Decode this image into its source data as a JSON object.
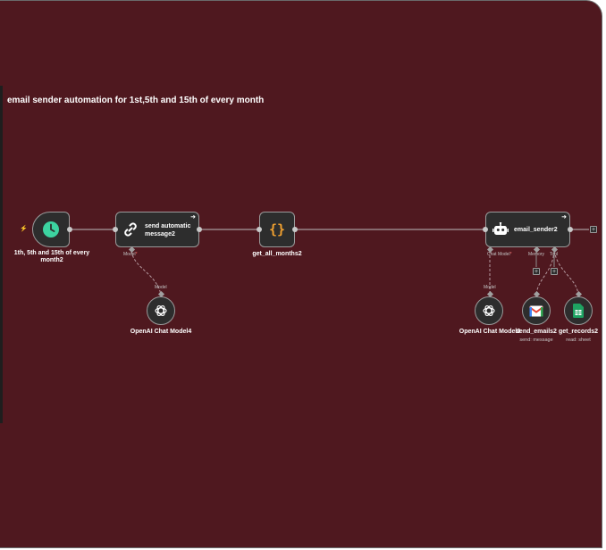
{
  "workflow": {
    "title": "email sender automation for 1st,5th and 15th of every month"
  },
  "nodes": {
    "trigger": {
      "caption": "1th, 5th and 15th of every month2",
      "icon": "clock-icon"
    },
    "send_message": {
      "label": "send automatic message2",
      "icon": "link-icon",
      "port_model": "Model"
    },
    "get_all_months": {
      "caption": "get_all_months2",
      "icon": "code-braces-icon"
    },
    "email_sender": {
      "label": "email_sender2",
      "icon": "robot-icon",
      "port_chat_model": "Chat Model",
      "port_memory": "Memory",
      "port_tool": "Tool"
    },
    "openai_model4": {
      "caption": "OpenAI Chat Model4",
      "port": "Model",
      "icon": "openai-icon"
    },
    "openai_model3": {
      "caption": "OpenAI Chat Model3",
      "port": "Model",
      "icon": "openai-icon"
    },
    "send_emails": {
      "caption": "send_emails2",
      "subtitle": "send: message",
      "icon": "gmail-icon"
    },
    "get_records": {
      "caption": "get_records2",
      "subtitle": "read: sheet",
      "icon": "sheets-icon"
    }
  },
  "colors": {
    "canvas": "#4f181f",
    "node": "#2d2d2d",
    "trigger_icon": "#3cd3a0",
    "code_icon": "#f0a030",
    "gmail_red": "#ea4335",
    "sheets_green": "#1ea362"
  }
}
